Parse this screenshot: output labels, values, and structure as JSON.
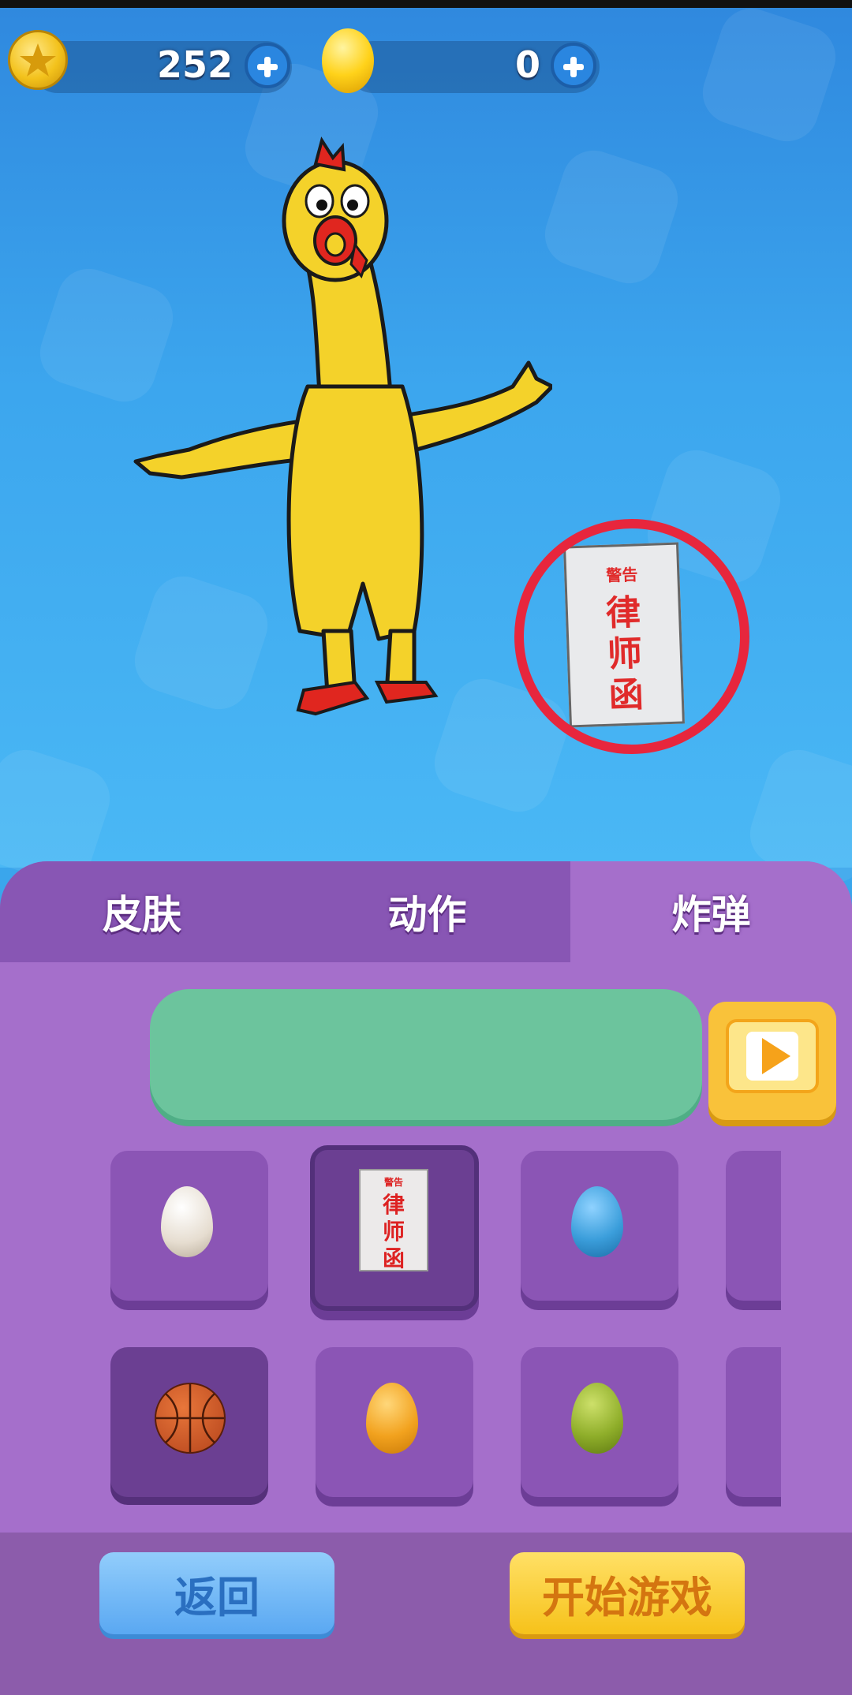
{
  "currency": {
    "coins_value": "252",
    "gems_value": "0",
    "coin_icon": "star-coin-icon",
    "gem_icon": "gold-egg-icon",
    "add_icon": "plus-icon"
  },
  "preview": {
    "character": "rubber-chicken",
    "bomb_item": {
      "header": "警告",
      "title_line1": "律",
      "title_line2": "师",
      "title_line3": "函"
    },
    "highlight_color": "#e7263d"
  },
  "tabs": [
    {
      "label": "皮肤",
      "active": false
    },
    {
      "label": "动作",
      "active": false
    },
    {
      "label": "炸弹",
      "active": true
    }
  ],
  "progress": {
    "color": "#6cc49d"
  },
  "video_button": {
    "icon": "play-video-icon"
  },
  "items": [
    {
      "name": "white-egg",
      "color": "#f2ede6"
    },
    {
      "name": "lawyer-letter",
      "selected": true
    },
    {
      "name": "blue-egg",
      "color": "#3b9edb"
    },
    {
      "name": "basketball",
      "selected_bg": true
    },
    {
      "name": "orange-egg",
      "color": "#f2a21e"
    },
    {
      "name": "green-egg",
      "color": "#8fae2a"
    }
  ],
  "buttons": {
    "back_label": "返回",
    "start_label": "开始游戏"
  },
  "colors": {
    "panel": "#a56fcb",
    "tab_dark": "#8856b4",
    "back_button": "#6fb6f6",
    "start_button": "#f9cf30"
  }
}
